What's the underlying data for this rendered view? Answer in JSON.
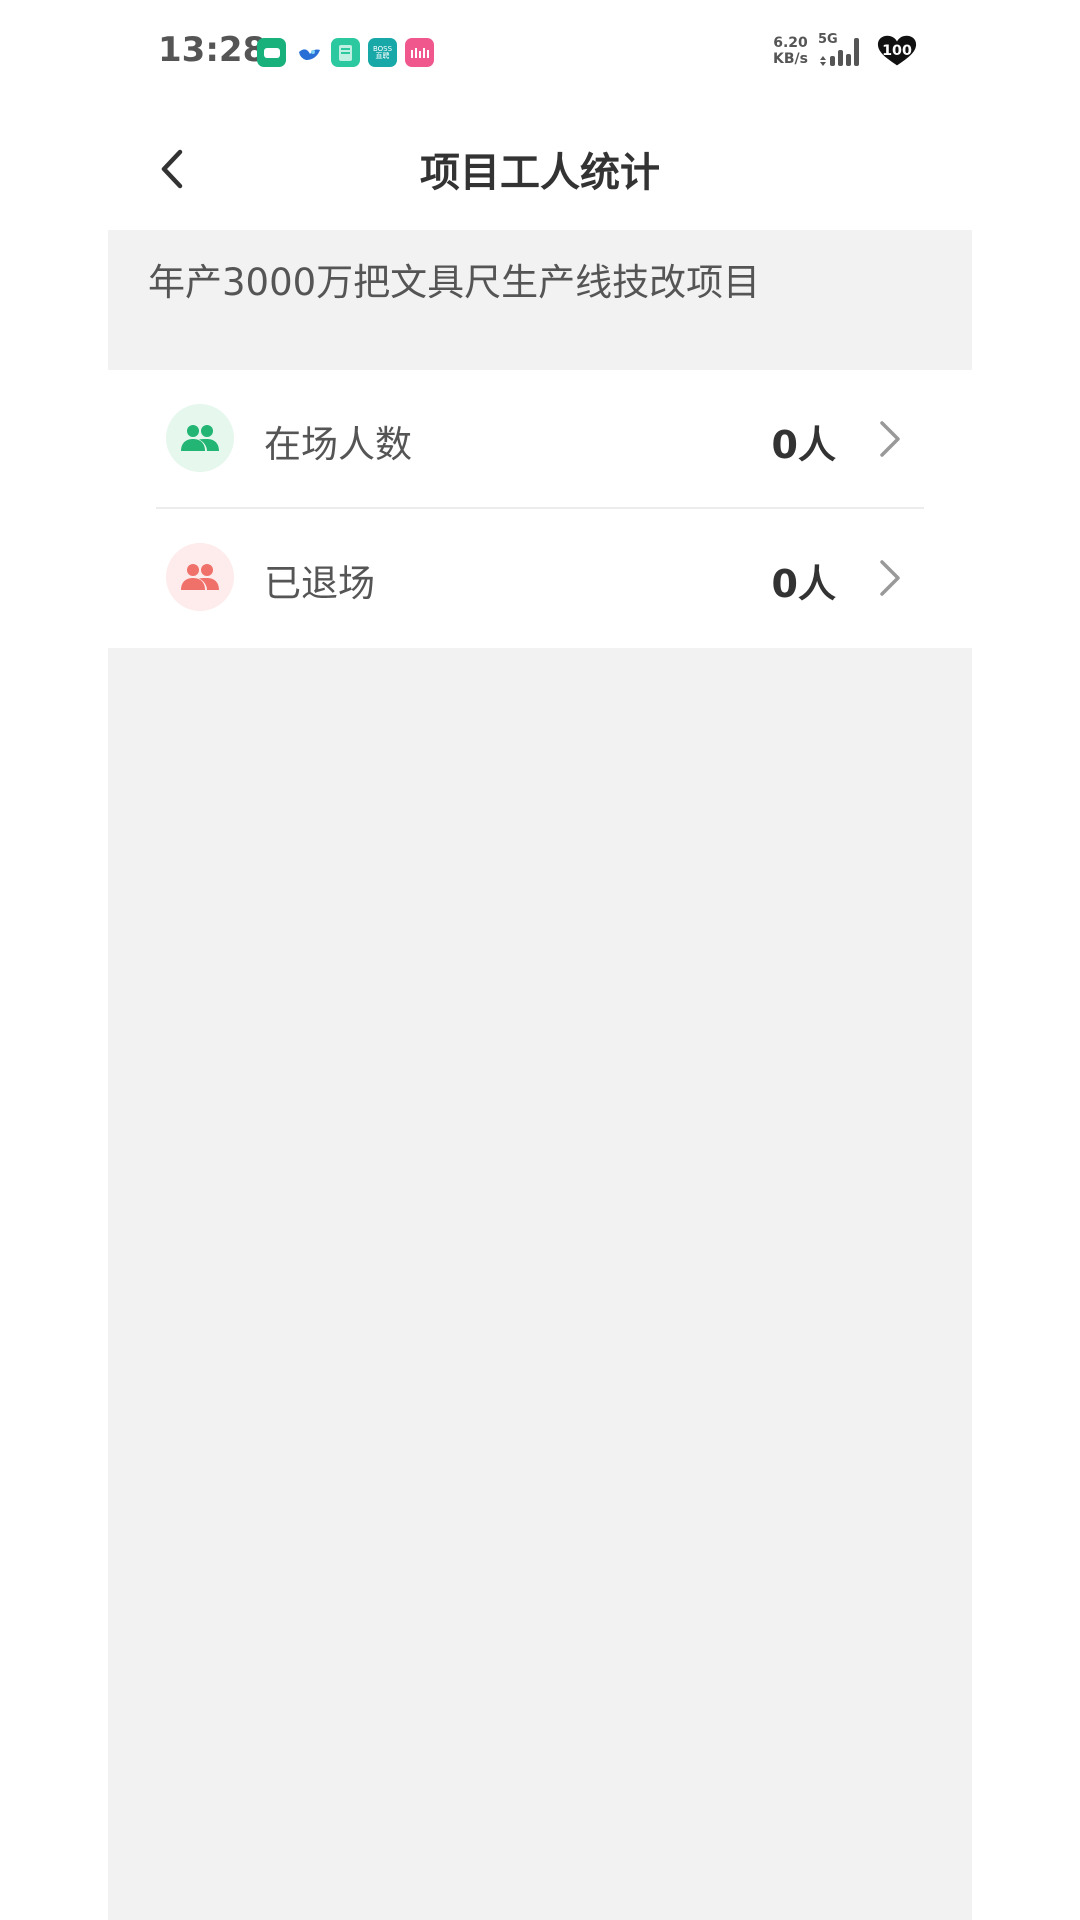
{
  "status_bar": {
    "time": "13:28",
    "notif_icons": [
      {
        "icon": "message-app-icon",
        "color": "#18b07b",
        "text": ""
      },
      {
        "icon": "bird-app-icon",
        "color": "#ffffff",
        "text": ""
      },
      {
        "icon": "document-app-icon",
        "color": "#2cc9a0",
        "text": ""
      },
      {
        "icon": "boss-app-icon",
        "color": "#18a8a8",
        "text": "BOSS 直聘"
      },
      {
        "icon": "bilibili-app-icon",
        "color": "#f0578c",
        "text": ""
      }
    ],
    "net_speed_value": "6.20",
    "net_speed_unit": "KB/s",
    "network": "5G",
    "battery": "100"
  },
  "nav": {
    "title": "项目工人统计"
  },
  "project": {
    "name": "年产3000万把文具尺生产线技改项目"
  },
  "stats": [
    {
      "label": "在场人数",
      "value": "0人",
      "icon": "people-icon",
      "icon_color": "#22b573",
      "icon_bg": "#e6f7ee"
    },
    {
      "label": "已退场",
      "value": "0人",
      "icon": "people-icon",
      "icon_color": "#f0706a",
      "icon_bg": "#fdeceb"
    }
  ],
  "colors": {
    "page_bg": "#f2f2f2",
    "text_primary": "#333333",
    "text_secondary": "#555555",
    "chevron": "#999999"
  }
}
